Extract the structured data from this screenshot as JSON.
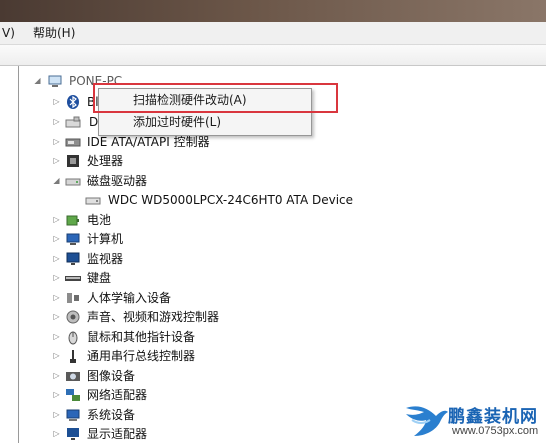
{
  "menubar": {
    "view_fragment": "V)",
    "help": "帮助(H)"
  },
  "tree": {
    "root": "PONE-PC",
    "items": [
      {
        "label": "Bl",
        "icon": "bluetooth-icon"
      },
      {
        "label": "D",
        "icon": "drive-icon"
      },
      {
        "label": "IDE ATA/ATAPI 控制器",
        "icon": "ide-controller-icon"
      },
      {
        "label": "处理器",
        "icon": "processor-icon"
      },
      {
        "label": "磁盘驱动器",
        "icon": "disk-drive-icon"
      },
      {
        "label": "WDC WD5000LPCX-24C6HT0 ATA Device",
        "icon": "hard-disk-icon"
      },
      {
        "label": "电池",
        "icon": "battery-icon"
      },
      {
        "label": "计算机",
        "icon": "computer-icon"
      },
      {
        "label": "监视器",
        "icon": "monitor-icon"
      },
      {
        "label": "键盘",
        "icon": "keyboard-icon"
      },
      {
        "label": "人体学输入设备",
        "icon": "hid-icon"
      },
      {
        "label": "声音、视频和游戏控制器",
        "icon": "sound-icon"
      },
      {
        "label": "鼠标和其他指针设备",
        "icon": "mouse-icon"
      },
      {
        "label": "通用串行总线控制器",
        "icon": "usb-icon"
      },
      {
        "label": "图像设备",
        "icon": "imaging-icon"
      },
      {
        "label": "网络适配器",
        "icon": "network-icon"
      },
      {
        "label": "系统设备",
        "icon": "system-device-icon"
      },
      {
        "label": "显示适配器",
        "icon": "display-adapter-icon"
      }
    ]
  },
  "context_menu": {
    "scan": "扫描检测硬件改动(A)",
    "add_legacy": "添加过时硬件(L)"
  },
  "watermark": {
    "title": "鹏鑫装机网",
    "url": "www.0753px.com"
  }
}
